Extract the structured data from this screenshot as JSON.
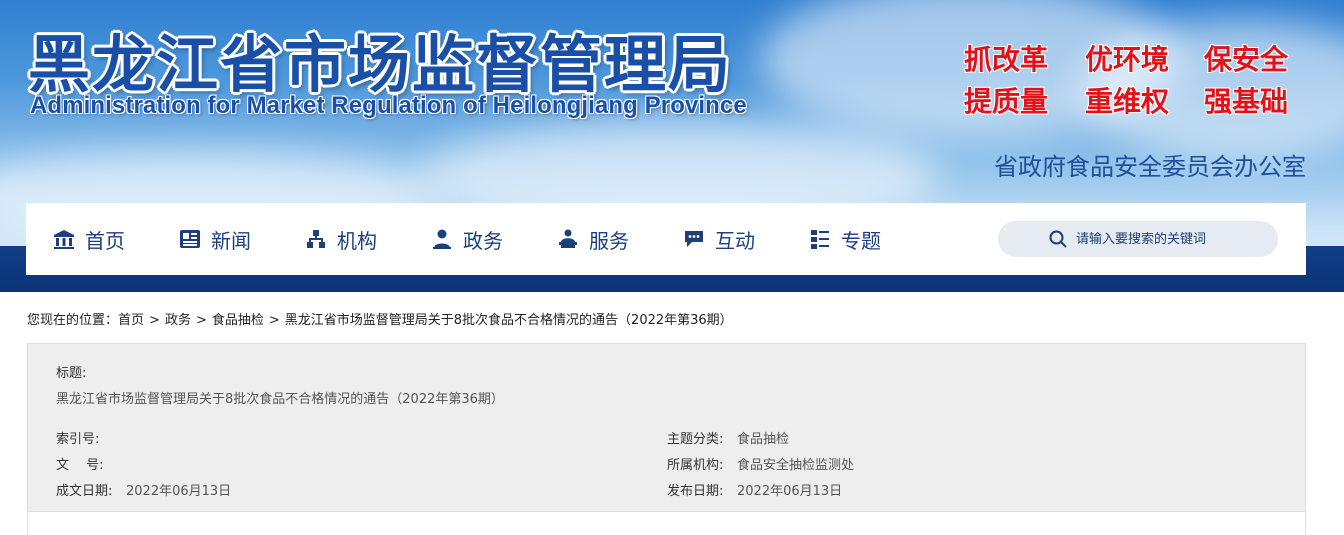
{
  "header": {
    "title": "黑龙江省市场监督管理局",
    "subtitle": "Administration for Market Regulation of Heilongjiang Province",
    "slogans": [
      "抓改革",
      "优环境",
      "保安全",
      "提质量",
      "重维权",
      "强基础"
    ],
    "office": "省政府食品安全委员会办公室",
    "colors": {
      "title": "#1a4fa8",
      "slogan": "#e0121a",
      "stripe": "#0c3378"
    }
  },
  "nav": {
    "items": [
      {
        "label": "首页",
        "icon": "bank-icon"
      },
      {
        "label": "新闻",
        "icon": "newspaper-icon"
      },
      {
        "label": "机构",
        "icon": "org-chart-icon"
      },
      {
        "label": "政务",
        "icon": "official-icon"
      },
      {
        "label": "服务",
        "icon": "service-icon"
      },
      {
        "label": "互动",
        "icon": "chat-icon"
      },
      {
        "label": "专题",
        "icon": "list-icon"
      }
    ],
    "search_placeholder": "请输入要搜索的关键词"
  },
  "breadcrumb": {
    "prefix": "您现在的位置：",
    "items": [
      "首页",
      "政务",
      "食品抽检",
      "黑龙江省市场监督管理局关于8批次食品不合格情况的通告（2022年第36期）"
    ]
  },
  "meta": {
    "title_label": "标题:",
    "title_value": "黑龙江省市场监督管理局关于8批次食品不合格情况的通告（2022年第36期）",
    "index_label": "索引号:",
    "index_value": "",
    "docno_label": "文　 号:",
    "docno_value": "",
    "created_label": "成文日期:",
    "created_value": "2022年06月13日",
    "topic_label": "主题分类:",
    "topic_value": "食品抽检",
    "org_label": "所属机构:",
    "org_value": "食品安全抽检监测处",
    "published_label": "发布日期:",
    "published_value": "2022年06月13日"
  }
}
